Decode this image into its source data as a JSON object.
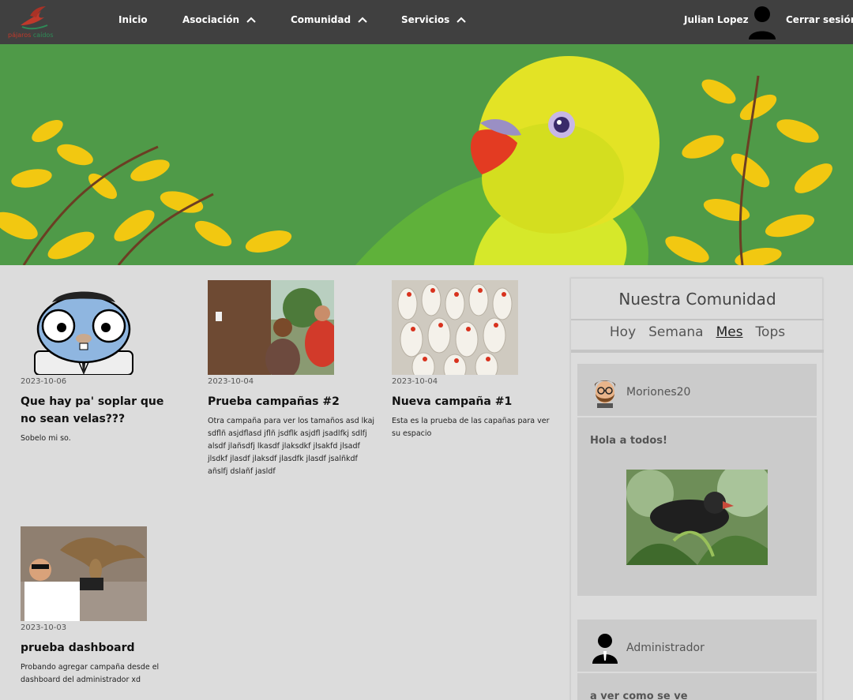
{
  "brand": {
    "logo_text_a": "pájaros",
    "logo_text_b": "caídos"
  },
  "nav": {
    "items": [
      {
        "label": "Inicio",
        "has_dropdown": false
      },
      {
        "label": "Asociación",
        "has_dropdown": true
      },
      {
        "label": "Comunidad",
        "has_dropdown": true
      },
      {
        "label": "Servicios",
        "has_dropdown": true
      }
    ],
    "user_name": "Julian Lopez",
    "logout_label": "Cerrar sesión"
  },
  "campaigns": [
    {
      "date": "2023-10-06",
      "title": "Que hay pa' soplar que no sean velas???",
      "description": "Sobelo mi so."
    },
    {
      "date": "2023-10-04",
      "title": "Prueba campañas #2",
      "description": "Otra campaña para ver los tamaños asd lkaj sdflñ asjdflasd jflñ jsdflk asjdfl jsadlfkj sdlfj alsdf jlañsdfj lkasdf jlaksdkf jlsakfd jlsadf jlsdkf jlasdf jlaksdf jlasdfk jlasdf jsalñkdf añslfj dslañf jasldf"
    },
    {
      "date": "2023-10-04",
      "title": "Nueva campaña #1",
      "description": "Esta es la prueba de las capañas para ver su espacio"
    },
    {
      "date": "2023-10-03",
      "title": "prueba dashboard",
      "description": "Probando agregar campaña desde el dashboard del administrador xd"
    }
  ],
  "community": {
    "title": "Nuestra Comunidad",
    "tabs": [
      "Hoy",
      "Semana",
      "Mes",
      "Tops"
    ],
    "active_tab": "Mes",
    "posts": [
      {
        "user": "Moriones20",
        "text": "Hola a todos!"
      },
      {
        "user": "Administrador",
        "text": "a ver como se ve"
      }
    ]
  },
  "colors": {
    "navbar": "#404040",
    "background": "#dcdcdc",
    "post_bg": "#cbcbcb"
  }
}
